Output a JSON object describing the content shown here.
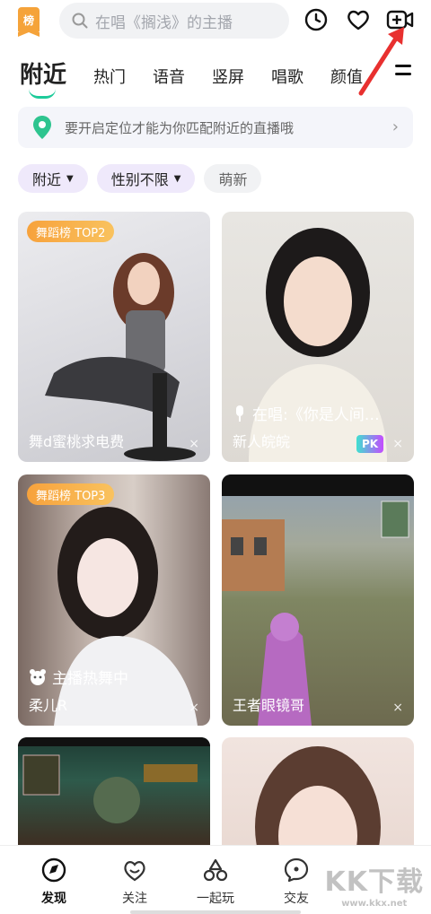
{
  "header": {
    "rank_badge": "榜",
    "search_placeholder": "在唱《搁浅》的主播",
    "icons": [
      "history-icon",
      "heart-icon",
      "go-live-icon"
    ]
  },
  "tabs": [
    {
      "label": "附近",
      "active": true
    },
    {
      "label": "热门"
    },
    {
      "label": "语音"
    },
    {
      "label": "竖屏"
    },
    {
      "label": "唱歌"
    },
    {
      "label": "颜值"
    }
  ],
  "banner": {
    "text": "要开启定位才能为你匹配附近的直播哦",
    "chevron": "›"
  },
  "filters": [
    {
      "label": "附近",
      "caret": "▼"
    },
    {
      "label": "性别不限",
      "caret": "▼"
    },
    {
      "label": "萌新"
    }
  ],
  "cards": [
    {
      "tag": "舞蹈榜 TOP2",
      "status": "",
      "name": "舞d蜜桃求电费",
      "close": "×"
    },
    {
      "tag": "",
      "status": "在唱:《你是人间…",
      "name": "新人皖皖",
      "badge": "PK",
      "close": "×"
    },
    {
      "tag": "舞蹈榜 TOP3",
      "status": "主播热舞中",
      "name": "柔儿R",
      "close": "×"
    },
    {
      "tag": "",
      "status": "",
      "name": "王者眼镜哥",
      "close": "×"
    },
    {
      "tag": "",
      "status": "",
      "name": "",
      "close": ""
    },
    {
      "tag": "",
      "status": "",
      "name": "",
      "close": ""
    }
  ],
  "bottom_nav": [
    {
      "label": "发现",
      "icon": "discover-icon",
      "active": true
    },
    {
      "label": "关注",
      "icon": "follow-icon"
    },
    {
      "label": "一起玩",
      "icon": "play-together-icon"
    },
    {
      "label": "交友",
      "icon": "chat-icon"
    }
  ],
  "watermark": {
    "text": "KK下载",
    "url": "www.kkx.net"
  },
  "colors": {
    "accent": "#1dcb9a",
    "tag": "#f7a23c",
    "chip": "#efe9fb",
    "arrow": "#e8302f"
  }
}
